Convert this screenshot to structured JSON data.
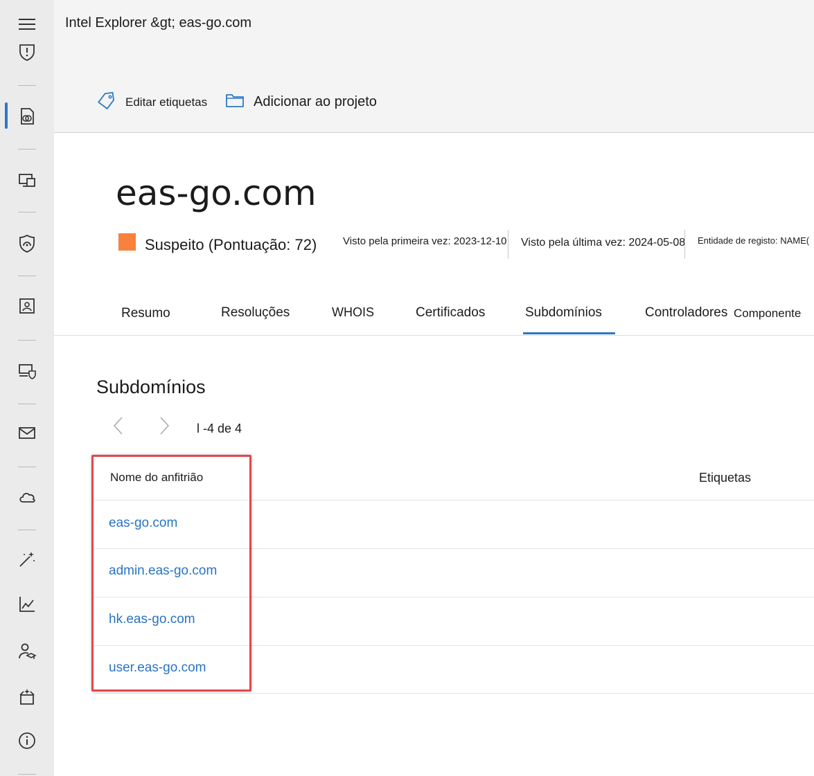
{
  "header": {
    "breadcrumb": "Intel Explorer &gt; eas-go.com"
  },
  "commands": {
    "edit_tags": "Editar etiquetas",
    "add_to_project": "Adicionar ao projeto"
  },
  "entity": {
    "title": "eas-go.com",
    "reputation": "Suspeito (Pontuação: 72)",
    "reputation_color": "#f7813d",
    "first_seen": "Visto pela primeira vez: 2023-12-10",
    "last_seen": "Visto pela última vez: 2024-05-08",
    "registrar": "Entidade de registo: NAME("
  },
  "tabs": [
    {
      "label": "Resumo"
    },
    {
      "label": "Resoluções"
    },
    {
      "label": "WHOIS"
    },
    {
      "label": "Certificados"
    },
    {
      "label": "Subdomínios",
      "selected": true
    },
    {
      "label": "Controladores"
    },
    {
      "label": "Componente"
    }
  ],
  "subdomains": {
    "title": "Subdomínios",
    "pagination": "l -4 de 4",
    "columns": {
      "host": "Nome do anfitrião",
      "tags": "Etiquetas"
    },
    "rows": [
      {
        "host": "eas-go.com"
      },
      {
        "host": "admin.eas-go.com"
      },
      {
        "host": "hk.eas-go.com"
      },
      {
        "host": "user.eas-go.com"
      }
    ]
  },
  "nav_icons": [
    "hamburger-menu-icon",
    "shield-alert-icon",
    "intel-document-icon",
    "devices-icon",
    "secure-score-icon",
    "identity-card-icon",
    "endpoint-security-icon",
    "mail-icon",
    "cloud-icon",
    "magic-wand-icon",
    "line-chart-icon",
    "learning-user-icon",
    "partner-box-icon",
    "info-icon"
  ],
  "colors": {
    "accent": "#2b78c5",
    "link": "#2874c2",
    "highlight": "#e0474c"
  }
}
